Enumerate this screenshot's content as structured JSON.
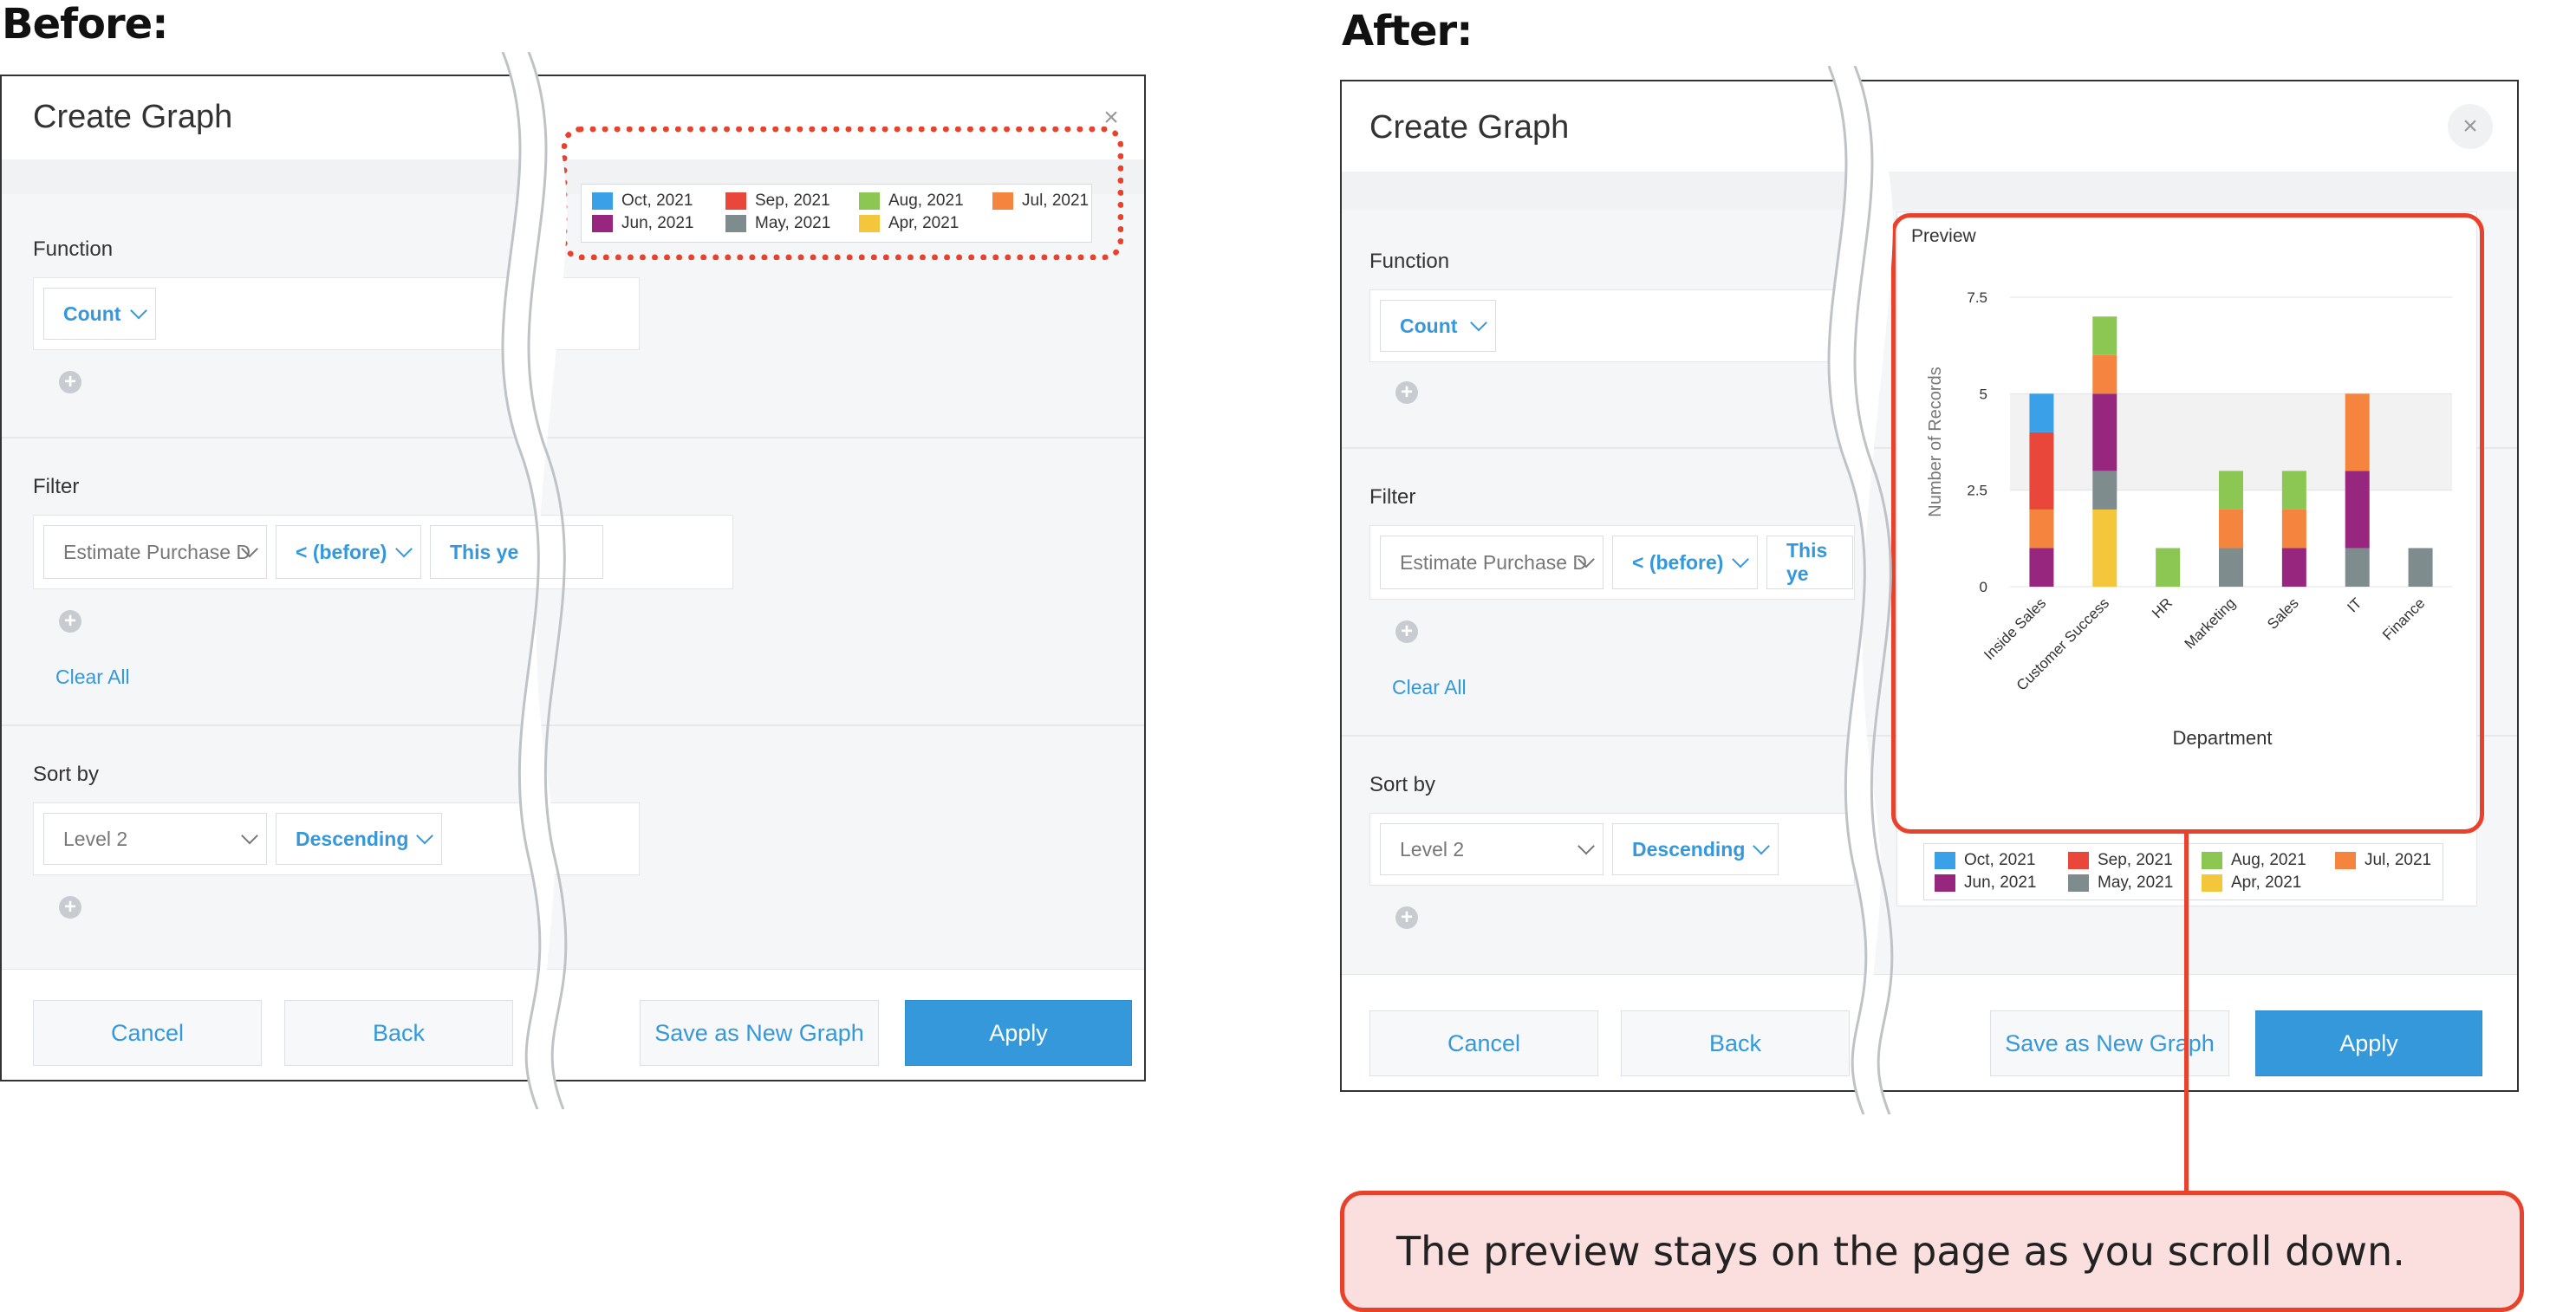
{
  "before": {
    "heading": "Before:",
    "dialog_title": "Create Graph",
    "close": "×",
    "function_label": "Function",
    "function_value": "Count",
    "filter_label": "Filter",
    "filter_field": "Estimate Purchase D",
    "filter_op": "< (before)",
    "filter_value": "This ye",
    "clear_all": "Clear All",
    "sort_label": "Sort by",
    "sort_field": "Level 2",
    "sort_order": "Descending",
    "buttons": {
      "cancel": "Cancel",
      "back": "Back",
      "save_new": "Save as New Graph",
      "apply": "Apply"
    }
  },
  "after": {
    "heading": "After:",
    "dialog_title": "Create Graph",
    "close": "×",
    "function_label": "Function",
    "function_value": "Count",
    "filter_label": "Filter",
    "filter_field": "Estimate Purchase D",
    "filter_op": "< (before)",
    "filter_value": "This ye",
    "clear_all": "Clear All",
    "sort_label": "Sort by",
    "sort_field": "Level 2",
    "sort_order": "Descending",
    "buttons": {
      "cancel": "Cancel",
      "back": "Back",
      "save_new": "Save as New Graph",
      "apply": "Apply"
    },
    "preview_label": "Preview"
  },
  "legend": [
    {
      "label": "Oct, 2021",
      "color": "#3aa0e8"
    },
    {
      "label": "Sep, 2021",
      "color": "#e8473a"
    },
    {
      "label": "Aug, 2021",
      "color": "#8cc653"
    },
    {
      "label": "Jul, 2021",
      "color": "#f5843e"
    },
    {
      "label": "Jun, 2021",
      "color": "#97277e"
    },
    {
      "label": "May, 2021",
      "color": "#7f8c8d"
    },
    {
      "label": "Apr, 2021",
      "color": "#f3c63c"
    }
  ],
  "callout": "The preview stays on the page as you scroll down.",
  "colors": {
    "accent": "#3498db",
    "highlight": "#e8412c"
  },
  "chart_data": {
    "type": "bar",
    "stacked": true,
    "categories": [
      "Inside Sales",
      "Customer Success",
      "HR",
      "Marketing",
      "Sales",
      "IT",
      "Finance"
    ],
    "series": [
      {
        "name": "Apr, 2021",
        "values": [
          0,
          2,
          0,
          0,
          0,
          0,
          0
        ]
      },
      {
        "name": "May, 2021",
        "values": [
          0,
          1,
          0,
          1,
          0,
          1,
          1
        ]
      },
      {
        "name": "Jun, 2021",
        "values": [
          1,
          2,
          0,
          0,
          1,
          2,
          0
        ]
      },
      {
        "name": "Jul, 2021",
        "values": [
          1,
          1,
          0,
          1,
          1,
          2,
          0
        ]
      },
      {
        "name": "Aug, 2021",
        "values": [
          0,
          1,
          1,
          1,
          1,
          0,
          0
        ]
      },
      {
        "name": "Sep, 2021",
        "values": [
          2,
          0,
          0,
          0,
          0,
          0,
          0
        ]
      },
      {
        "name": "Oct, 2021",
        "values": [
          1,
          0,
          0,
          0,
          0,
          0,
          0
        ]
      }
    ],
    "ylim": [
      0,
      7.5
    ],
    "yticks": [
      "0",
      "2.5",
      "5",
      "7.5"
    ],
    "xlabel": "Department",
    "ylabel": "Number of Records",
    "grid": true,
    "legend_position": "bottom"
  }
}
